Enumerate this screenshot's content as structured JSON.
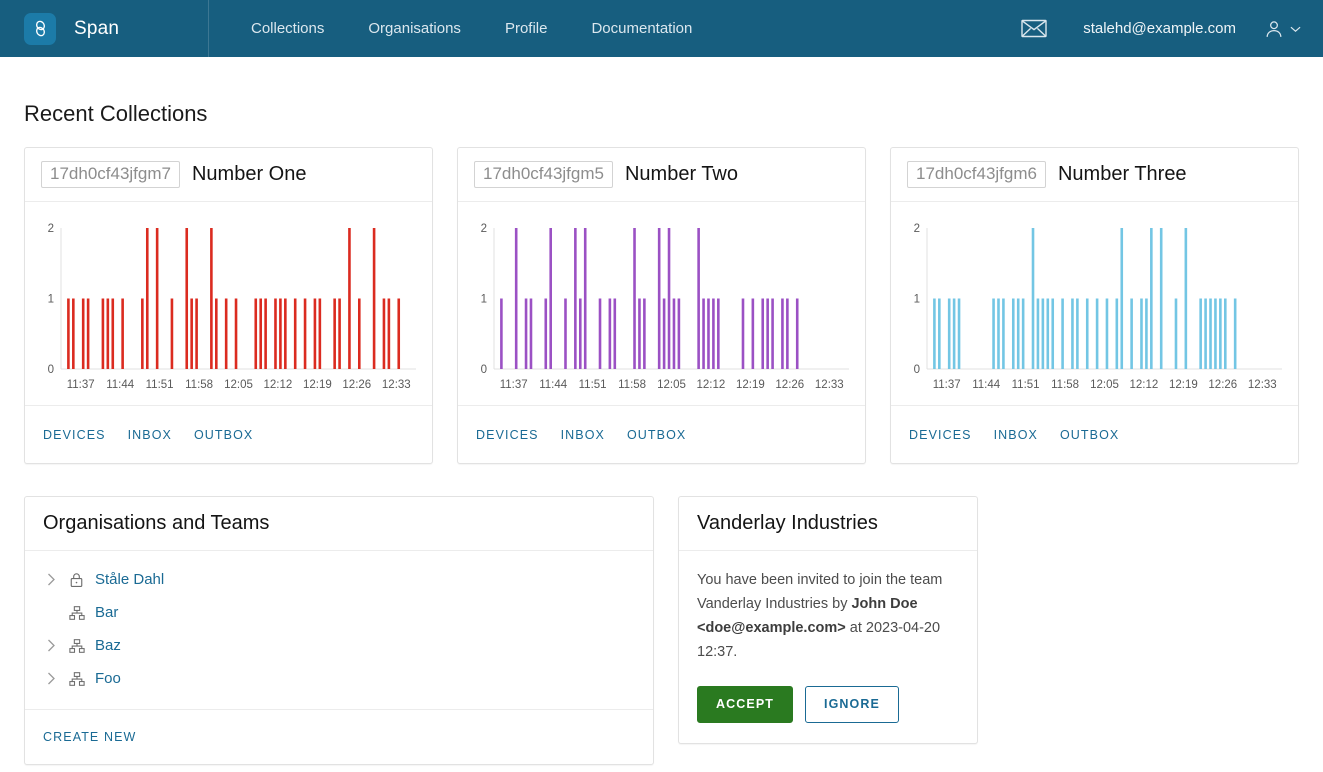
{
  "header": {
    "brand_name": "Span",
    "nav": [
      {
        "label": "Collections"
      },
      {
        "label": "Organisations"
      },
      {
        "label": "Profile"
      },
      {
        "label": "Documentation"
      }
    ],
    "user_email": "stalehd@example.com",
    "mail_icon": "envelope-icon",
    "avatar_icon": "user-icon",
    "chevron_icon": "chevron-down-icon",
    "brand_color": "#175E7F",
    "logo_color": "#1C7BA8"
  },
  "main": {
    "page_title": "Recent Collections",
    "card_links": [
      "Devices",
      "Inbox",
      "Outbox"
    ],
    "cards": [
      {
        "id": "17dh0cf43jfgm7",
        "title": "Number One"
      },
      {
        "id": "17dh0cf43jfgm5",
        "title": "Number Two"
      },
      {
        "id": "17dh0cf43jfgm6",
        "title": "Number Three"
      }
    ]
  },
  "chart_data": [
    {
      "type": "bar",
      "title": "Number One",
      "color": "#DB2B20",
      "xlabel": "",
      "ylabel": "",
      "ylim": [
        0,
        2
      ],
      "yticks": [
        0,
        1,
        2
      ],
      "grid": false,
      "tick_labels": [
        "11:37",
        "11:44",
        "11:51",
        "11:58",
        "12:05",
        "12:12",
        "12:19",
        "12:26",
        "12:33"
      ],
      "slots": 72,
      "values": [
        0,
        1,
        1,
        0,
        1,
        1,
        0,
        0,
        1,
        1,
        1,
        0,
        1,
        0,
        0,
        0,
        1,
        2,
        0,
        2,
        0,
        0,
        1,
        0,
        0,
        2,
        1,
        1,
        0,
        0,
        2,
        1,
        0,
        1,
        0,
        1,
        0,
        0,
        0,
        1,
        1,
        1,
        0,
        1,
        1,
        1,
        0,
        1,
        0,
        1,
        0,
        1,
        1,
        0,
        0,
        1,
        1,
        0,
        2,
        0,
        1,
        0,
        0,
        2,
        0,
        1,
        1,
        0,
        1,
        0,
        0,
        0
      ]
    },
    {
      "type": "bar",
      "title": "Number Two",
      "color": "#9B51C4",
      "xlabel": "",
      "ylabel": "",
      "ylim": [
        0,
        2
      ],
      "yticks": [
        0,
        1,
        2
      ],
      "grid": false,
      "tick_labels": [
        "11:37",
        "11:44",
        "11:51",
        "11:58",
        "12:05",
        "12:12",
        "12:19",
        "12:26",
        "12:33"
      ],
      "slots": 72,
      "values": [
        0,
        1,
        0,
        0,
        2,
        0,
        1,
        1,
        0,
        0,
        1,
        2,
        0,
        0,
        1,
        0,
        2,
        1,
        2,
        0,
        0,
        1,
        0,
        1,
        1,
        0,
        0,
        0,
        2,
        1,
        1,
        0,
        0,
        2,
        1,
        2,
        1,
        1,
        0,
        0,
        0,
        2,
        1,
        1,
        1,
        1,
        0,
        0,
        0,
        0,
        1,
        0,
        1,
        0,
        1,
        1,
        1,
        0,
        1,
        1,
        0,
        1,
        0,
        0,
        0,
        0,
        0,
        0,
        0,
        0,
        0,
        0
      ]
    },
    {
      "type": "bar",
      "title": "Number Three",
      "color": "#73C6E4",
      "xlabel": "",
      "ylabel": "",
      "ylim": [
        0,
        2
      ],
      "yticks": [
        0,
        1,
        2
      ],
      "grid": false,
      "tick_labels": [
        "11:37",
        "11:44",
        "11:51",
        "11:58",
        "12:05",
        "12:12",
        "12:19",
        "12:26",
        "12:33"
      ],
      "slots": 72,
      "values": [
        0,
        1,
        1,
        0,
        1,
        1,
        1,
        0,
        0,
        0,
        0,
        0,
        0,
        1,
        1,
        1,
        0,
        1,
        1,
        1,
        0,
        2,
        1,
        1,
        1,
        1,
        0,
        1,
        0,
        1,
        1,
        0,
        1,
        0,
        1,
        0,
        1,
        0,
        1,
        2,
        0,
        1,
        0,
        1,
        1,
        2,
        0,
        2,
        0,
        0,
        1,
        0,
        2,
        0,
        0,
        1,
        1,
        1,
        1,
        1,
        1,
        0,
        1,
        0,
        0,
        0,
        0,
        0,
        0,
        0,
        0,
        0
      ]
    }
  ],
  "organisations": {
    "title": "Organisations and Teams",
    "create_new_label": "Create New",
    "items": [
      {
        "label": "Ståle Dahl",
        "icon": "lock-icon",
        "has_twisty": true
      },
      {
        "label": "Bar",
        "icon": "team-icon",
        "has_twisty": false
      },
      {
        "label": "Baz",
        "icon": "team-icon",
        "has_twisty": true
      },
      {
        "label": "Foo",
        "icon": "team-icon",
        "has_twisty": true
      }
    ]
  },
  "invite": {
    "title": "Vanderlay Industries",
    "text_part1": "You have been invited to join the team Vanderlay Industries by ",
    "inviter": "John Doe <doe@example.com>",
    "text_part2": " at 2023-04-20 12:37.",
    "accept_label": "Accept",
    "ignore_label": "Ignore",
    "accept_color": "#2A7A20"
  }
}
